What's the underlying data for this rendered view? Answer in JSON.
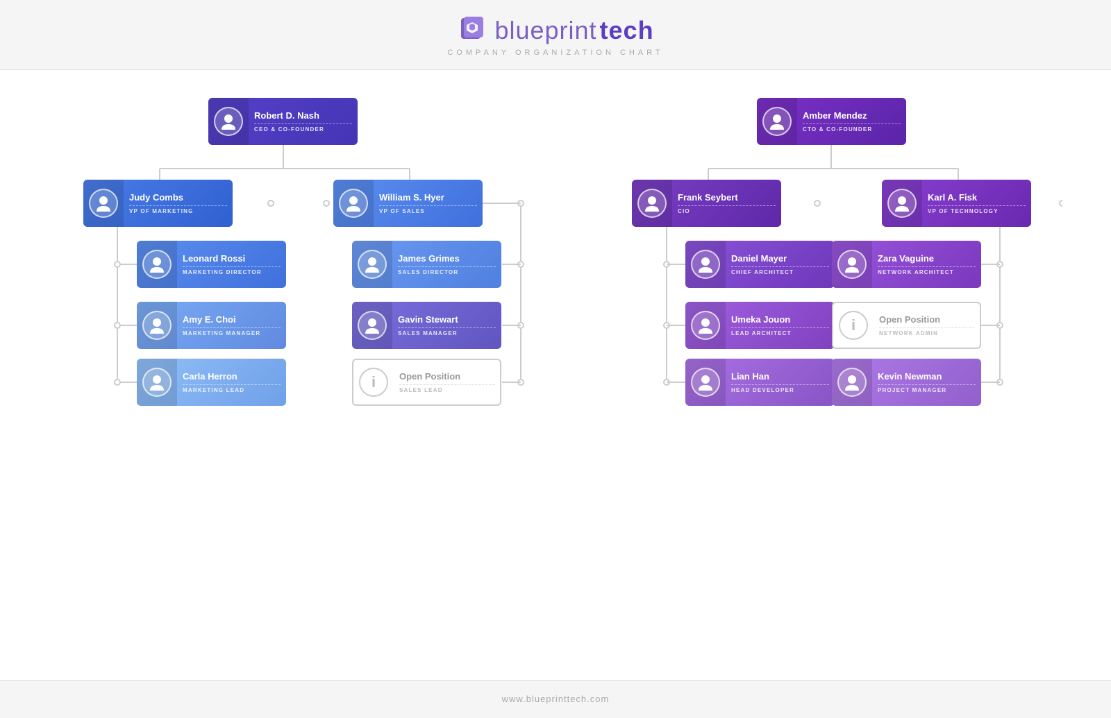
{
  "header": {
    "logo_text": "blueprint",
    "logo_bold": "tech",
    "subtitle": "COMPANY  ORGANIZATION  CHART"
  },
  "footer": {
    "url": "www.blueprinttech.com"
  },
  "colors": {
    "ceo_card": "#5540c8",
    "ceo_icon": "#4535b5",
    "cto_card": "#6e30b8",
    "cto_icon": "#5a25a0",
    "blue_bright": "#4a7de8",
    "blue_mid": "#5b8ef0",
    "blue_light": "#7aabf5",
    "blue_pale": "#90bff8",
    "purple_vp": "#7c3fc5",
    "purple_arch": "#8b52d8",
    "purple_lead": "#a060e0",
    "purple_dev": "#aa70e5",
    "connector": "#cccccc"
  },
  "left_tree": {
    "root": {
      "name": "Robert D. Nash",
      "role": "CEO & CO-FOUNDER",
      "color_class": "ceo"
    },
    "left_branch": {
      "vp": {
        "name": "Judy Combs",
        "role": "VP OF MARKETING",
        "color": "#4a7de8"
      },
      "children": [
        {
          "name": "Leonard Rossi",
          "role": "MARKETING DIRECTOR",
          "color": "#5b8ef0"
        },
        {
          "name": "Amy E. Choi",
          "role": "MARKETING MANAGER",
          "color": "#7aabf5"
        },
        {
          "name": "Carla Herron",
          "role": "MARKETING LEAD",
          "color": "#90bff8"
        }
      ]
    },
    "right_branch": {
      "vp": {
        "name": "William S. Hyer",
        "role": "VP OF SALES",
        "color": "#5b8ef0"
      },
      "children": [
        {
          "name": "James Grimes",
          "role": "SALES DIRECTOR",
          "color": "#6b9af2"
        },
        {
          "name": "Gavin Stewart",
          "role": "SALES MANAGER",
          "color": "#7b6fde"
        },
        {
          "name": "Open Position",
          "role": "SALES LEAD",
          "open": true
        }
      ]
    }
  },
  "right_tree": {
    "root": {
      "name": "Amber Mendez",
      "role": "CTO & CO-FOUNDER",
      "color_class": "cto"
    },
    "left_branch": {
      "vp": {
        "name": "Frank Seybert",
        "role": "CIO",
        "color": "#7b3fc5"
      },
      "children": [
        {
          "name": "Daniel Mayer",
          "role": "CHIEF ARCHITECT",
          "color": "#8b52d8"
        },
        {
          "name": "Umeka Jouon",
          "role": "LEAD ARCHITECT",
          "color": "#a060e0"
        },
        {
          "name": "Lian Han",
          "role": "HEAD DEVELOPER",
          "color": "#aa70e5"
        }
      ]
    },
    "right_branch": {
      "vp": {
        "name": "Karl A. Fisk",
        "role": "VP OF TECHNOLOGY",
        "color": "#8840d0"
      },
      "children": [
        {
          "name": "Zara Vaguine",
          "role": "NETWORK ARCHITECT",
          "color": "#9955dc"
        },
        {
          "name": "Open Position",
          "role": "NETWORK ADMIN",
          "open": true
        },
        {
          "name": "Kevin Newman",
          "role": "PROJECT MANAGER",
          "color": "#b07ae8"
        }
      ]
    }
  }
}
